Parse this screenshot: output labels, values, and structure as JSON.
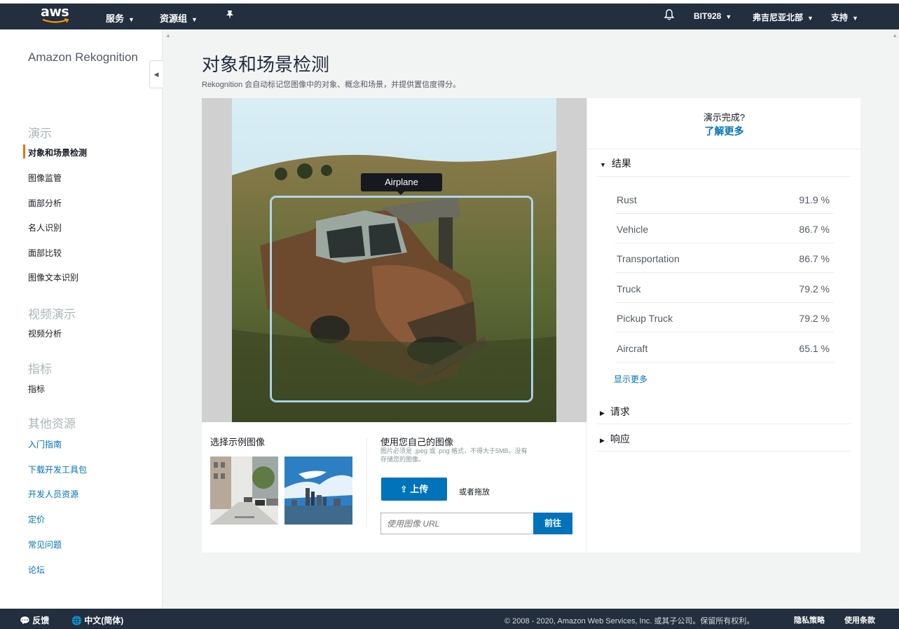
{
  "topnav": {
    "logo": "aws",
    "services": "服务",
    "resource_groups": "资源组",
    "account": "BIT928",
    "region": "弗吉尼亚北部",
    "support": "支持"
  },
  "sidebar": {
    "title": "Amazon Rekognition",
    "sections": [
      {
        "heading": "演示",
        "items": [
          "对象和场景检测",
          "图像监管",
          "面部分析",
          "名人识别",
          "面部比较",
          "图像文本识别"
        ]
      },
      {
        "heading": "视频演示",
        "items": [
          "视频分析"
        ]
      },
      {
        "heading": "指标",
        "items": [
          "指标"
        ]
      },
      {
        "heading": "其他资源",
        "items": [
          "入门指南",
          "下载开发工具包",
          "开发人员资源",
          "定价",
          "常见问题",
          "论坛"
        ]
      }
    ]
  },
  "main": {
    "title": "对象和场景检测",
    "description": "Rekognition 会自动标记您图像中的对象、概念和场景，并提供置信度得分。",
    "bbox_label": "Airplane",
    "sample_title": "选择示例图像",
    "own_title": "使用您自己的图像",
    "own_note": "图片必须是 .jpeg 或 .png 格式，不得大于5MB。没有存储您的图像。",
    "upload_label": "上传",
    "or_drag": "或者拖放",
    "url_placeholder": "使用图像 URL",
    "go_label": "前往"
  },
  "results_panel": {
    "question": "演示完成?",
    "learn_more": "了解更多",
    "results_heading": "结果",
    "results": [
      {
        "label": "Rust",
        "value": "91.9 %"
      },
      {
        "label": "Vehicle",
        "value": "86.7 %"
      },
      {
        "label": "Transportation",
        "value": "86.7 %"
      },
      {
        "label": "Truck",
        "value": "79.2 %"
      },
      {
        "label": "Pickup Truck",
        "value": "79.2 %"
      },
      {
        "label": "Aircraft",
        "value": "65.1 %"
      }
    ],
    "show_more": "显示更多",
    "request_heading": "请求",
    "response_heading": "响应"
  },
  "footer": {
    "feedback": "反馈",
    "language": "中文(简体)",
    "copyright": "© 2008 - 2020, Amazon Web Services, Inc. 或其子公司。保留所有权利。",
    "privacy": "隐私策略",
    "terms": "使用条款"
  }
}
